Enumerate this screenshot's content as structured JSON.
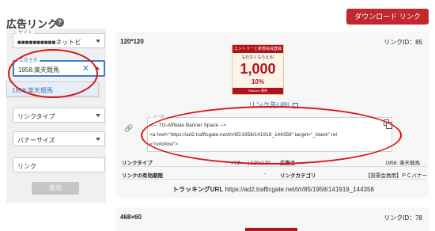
{
  "header": {
    "title": "広告リンク",
    "help_icon": "?",
    "download_label": "ダウンロード リンク"
  },
  "filters": {
    "site": {
      "label": "サイト",
      "value": "■■■■■■■■■■ネットビ"
    },
    "advertiser": {
      "label": "広告主名",
      "value": "1958:楽天競馬"
    },
    "dropdown_option": "1958:楽天競馬",
    "link_type": "リンクタイプ",
    "banner_size": "バナーサイズ",
    "link": "リンク",
    "search_label": "表示"
  },
  "card1": {
    "size": "120*120",
    "link_id": "リンクID：85",
    "banner": {
      "top_text": "エントリーと新規会員登録で",
      "sub_text": "もれなくもらえる!",
      "amount": "1,000",
      "percent": "10%",
      "footer": "Rakuten 競馬"
    },
    "link_url_label": "リンク先URL",
    "source_legend": "ソース",
    "code_lines": [
      "<!-- TG-Affiliate Banner Space -->",
      "<a href=\"https://ad2.trafficgate.net/t/r/85/1958/141919_144358\" target=\"_blank\" rel",
      "=\"nofollow\">"
    ],
    "info": {
      "link_type_label": "リンクタイプ",
      "link_type_value": "バナー | 120x120",
      "advertiser_label": "広告主",
      "advertiser_value": "1958: 楽天競馬",
      "valid_label": "リンクの有効期限",
      "valid_value": "-",
      "category_label": "リンクカテゴリ",
      "category_value": "【投票会員用】ＰＣバナー"
    },
    "tracking_label": "トラッキングURL",
    "tracking_url": "https://ad2.trafficgate.net/t/r/85/1958/141919_144358"
  },
  "card2": {
    "size": "468×60",
    "link_id": "リンクID：78"
  },
  "colors": {
    "accent_red": "#c0282d",
    "focus_blue": "#3f7cd4",
    "link_blue": "#2b65c2",
    "annotation_red": "#dd1111"
  }
}
